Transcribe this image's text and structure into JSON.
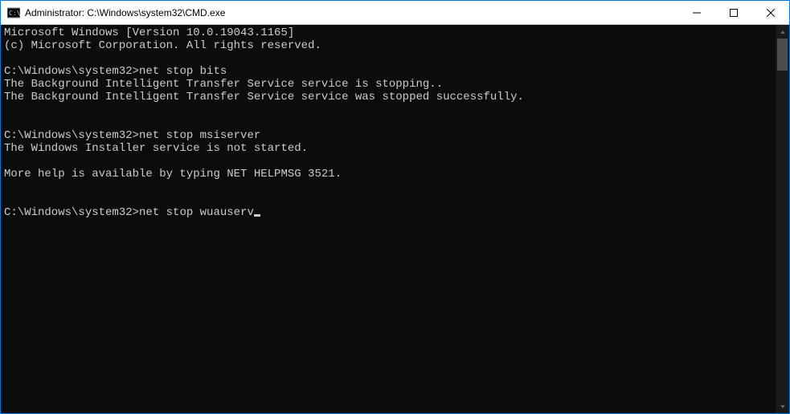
{
  "window": {
    "title": "Administrator: C:\\Windows\\system32\\CMD.exe"
  },
  "console": {
    "version_line": "Microsoft Windows [Version 10.0.19043.1165]",
    "copyright_line": "(c) Microsoft Corporation. All rights reserved.",
    "prompt": "C:\\Windows\\system32>",
    "block1": {
      "command": "net stop bits",
      "out1": "The Background Intelligent Transfer Service service is stopping..",
      "out2": "The Background Intelligent Transfer Service service was stopped successfully."
    },
    "block2": {
      "command": "net stop msiserver",
      "out1": "The Windows Installer service is not started.",
      "out2": "More help is available by typing NET HELPMSG 3521."
    },
    "block3": {
      "command": "net stop wuauserv"
    }
  }
}
